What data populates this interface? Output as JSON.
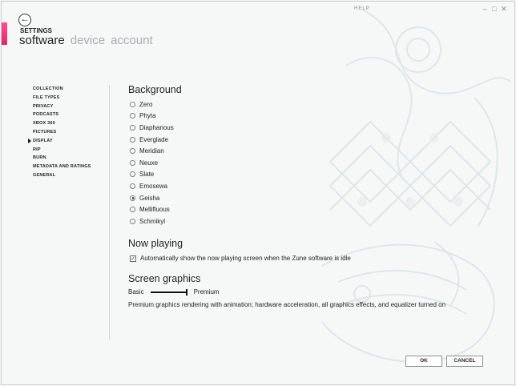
{
  "header": {
    "help_label": "HELP",
    "settings_label": "SETTINGS",
    "window_buttons": [
      "–",
      "□",
      "✕"
    ],
    "pivots": [
      {
        "label": "software",
        "active": true
      },
      {
        "label": "device",
        "active": false
      },
      {
        "label": "account",
        "active": false
      }
    ]
  },
  "sidebar": {
    "selected": "DISPLAY",
    "items": [
      {
        "label": "COLLECTION"
      },
      {
        "label": "FILE TYPES"
      },
      {
        "label": "PRIVACY"
      },
      {
        "label": "PODCASTS"
      },
      {
        "label": "XBOX 360"
      },
      {
        "label": "PICTURES"
      },
      {
        "label": "DISPLAY"
      },
      {
        "label": "RIP"
      },
      {
        "label": "BURN"
      },
      {
        "label": "METADATA AND RATINGS"
      },
      {
        "label": "GENERAL"
      }
    ]
  },
  "background": {
    "heading": "Background",
    "selected": "Geisha",
    "options": [
      {
        "label": "Zero"
      },
      {
        "label": "Phyta"
      },
      {
        "label": "Diaphanous"
      },
      {
        "label": "Everglade"
      },
      {
        "label": "Meridian"
      },
      {
        "label": "Neuxe"
      },
      {
        "label": "Slate"
      },
      {
        "label": "Emosewa"
      },
      {
        "label": "Geisha"
      },
      {
        "label": "Mellifluous"
      },
      {
        "label": "Schmikyl"
      }
    ]
  },
  "now_playing": {
    "heading": "Now playing",
    "checkbox_label": "Automatically show the now playing screen when the Zune software is idle",
    "checked": true
  },
  "screen_graphics": {
    "heading": "Screen graphics",
    "min_label": "Basic",
    "max_label": "Premium",
    "level": 1.0,
    "description": "Premium graphics rendering with animation; hardware acceleration, all graphics effects, and equalizer turned on"
  },
  "footer": {
    "ok_label": "OK",
    "cancel_label": "CANCEL"
  },
  "colors": {
    "accent_pink": "#e2256f",
    "text": "#222222",
    "inactive_pivot": "#a8adb0"
  }
}
